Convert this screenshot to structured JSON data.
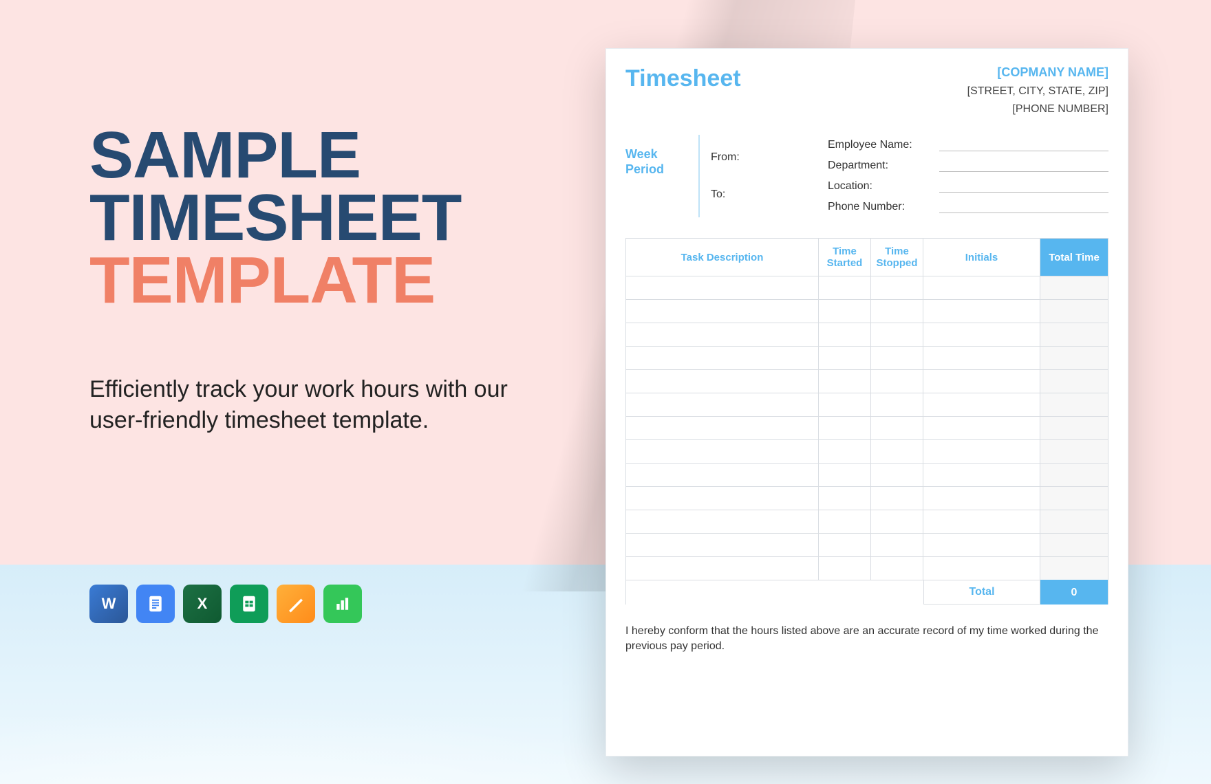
{
  "title": {
    "line1": "SAMPLE",
    "line2": "TIMESHEET",
    "line3": "TEMPLATE"
  },
  "subtitle": "Efficiently track your work hours with our user-friendly timesheet template.",
  "apps": {
    "word": {
      "name": "word-icon",
      "label": "W"
    },
    "docs": {
      "name": "google-docs-icon"
    },
    "excel": {
      "name": "excel-icon",
      "label": "X"
    },
    "sheets": {
      "name": "google-sheets-icon"
    },
    "pages": {
      "name": "apple-pages-icon"
    },
    "numbers": {
      "name": "apple-numbers-icon"
    }
  },
  "preview": {
    "title": "Timesheet",
    "company": {
      "name": "[COPMANY NAME]",
      "address": "[STREET, CITY, STATE, ZIP]",
      "phone": "[PHONE NUMBER]"
    },
    "week_period_label": "Week Period",
    "from_label": "From:",
    "to_label": "To:",
    "employee_fields": {
      "name": "Employee Name:",
      "department": "Department:",
      "location": "Location:",
      "phone": "Phone Number:"
    },
    "columns": {
      "task": "Task Description",
      "start": "Time Started",
      "stop": "Time Stopped",
      "initials": "Initials",
      "total": "Total Time"
    },
    "row_count": 13,
    "footer": {
      "label": "Total",
      "value": "0"
    },
    "note": "I hereby conform that the hours listed above are an accurate record of my time worked during the previous pay period."
  }
}
